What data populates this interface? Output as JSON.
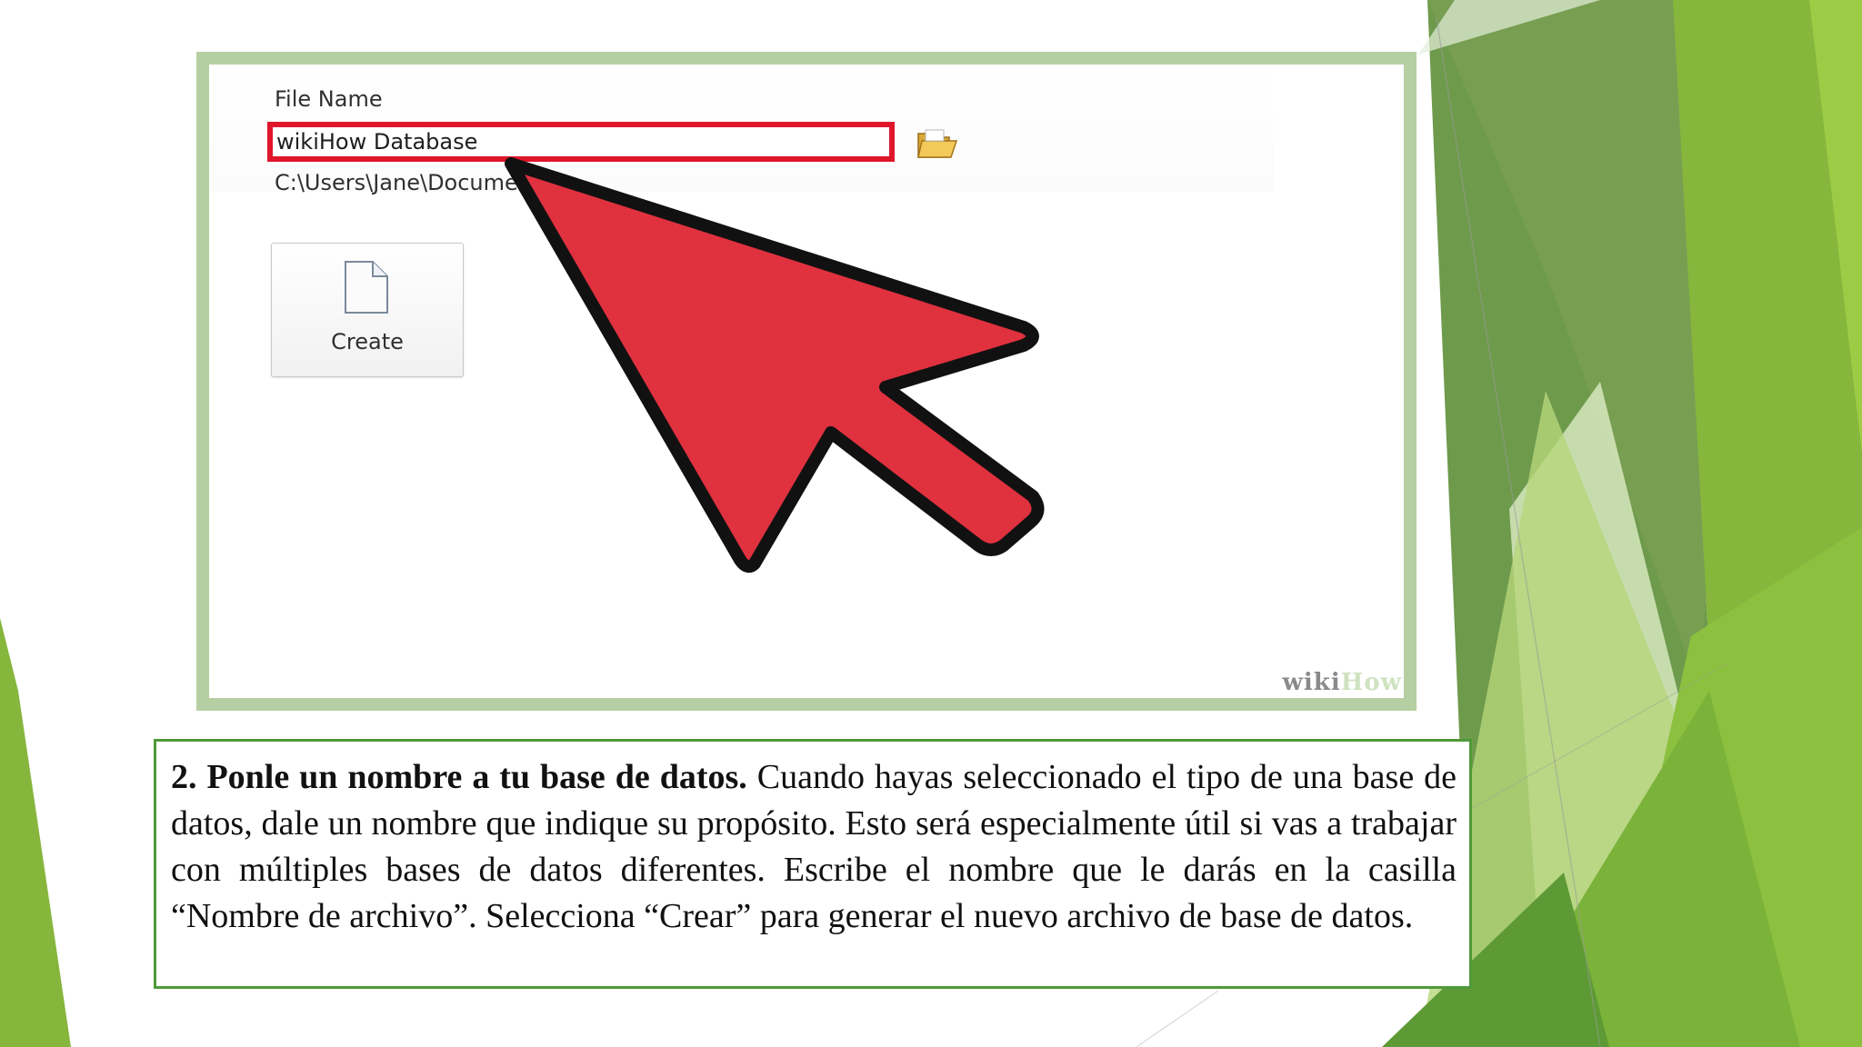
{
  "dialog": {
    "file_name_label": "File Name",
    "file_name_value": "wikiHow Database",
    "path_text": "C:\\Users\\Jane\\Documents\\",
    "create_label": "Create",
    "folder_icon": "folder-open-icon",
    "document_icon": "document-icon"
  },
  "watermark": {
    "part1": "wiki",
    "part2": "How"
  },
  "caption": {
    "bold_text": "2. Ponle un nombre a tu base de datos.",
    "body_text": " Cuando hayas seleccionado el tipo de una base de datos, dale un nombre que indique su propósito. Esto será especialmente útil si vas a trabajar con múltiples bases de datos diferentes. Escribe el nombre que le darás en la casilla “Nombre de archivo”. Selecciona “Crear” para generar el nuevo archivo de base de datos."
  },
  "colors": {
    "highlight_red": "#e0162b",
    "arrow_red": "#e0313f",
    "frame_green": "#b6cfa2",
    "caption_border": "#4f9a3a"
  }
}
